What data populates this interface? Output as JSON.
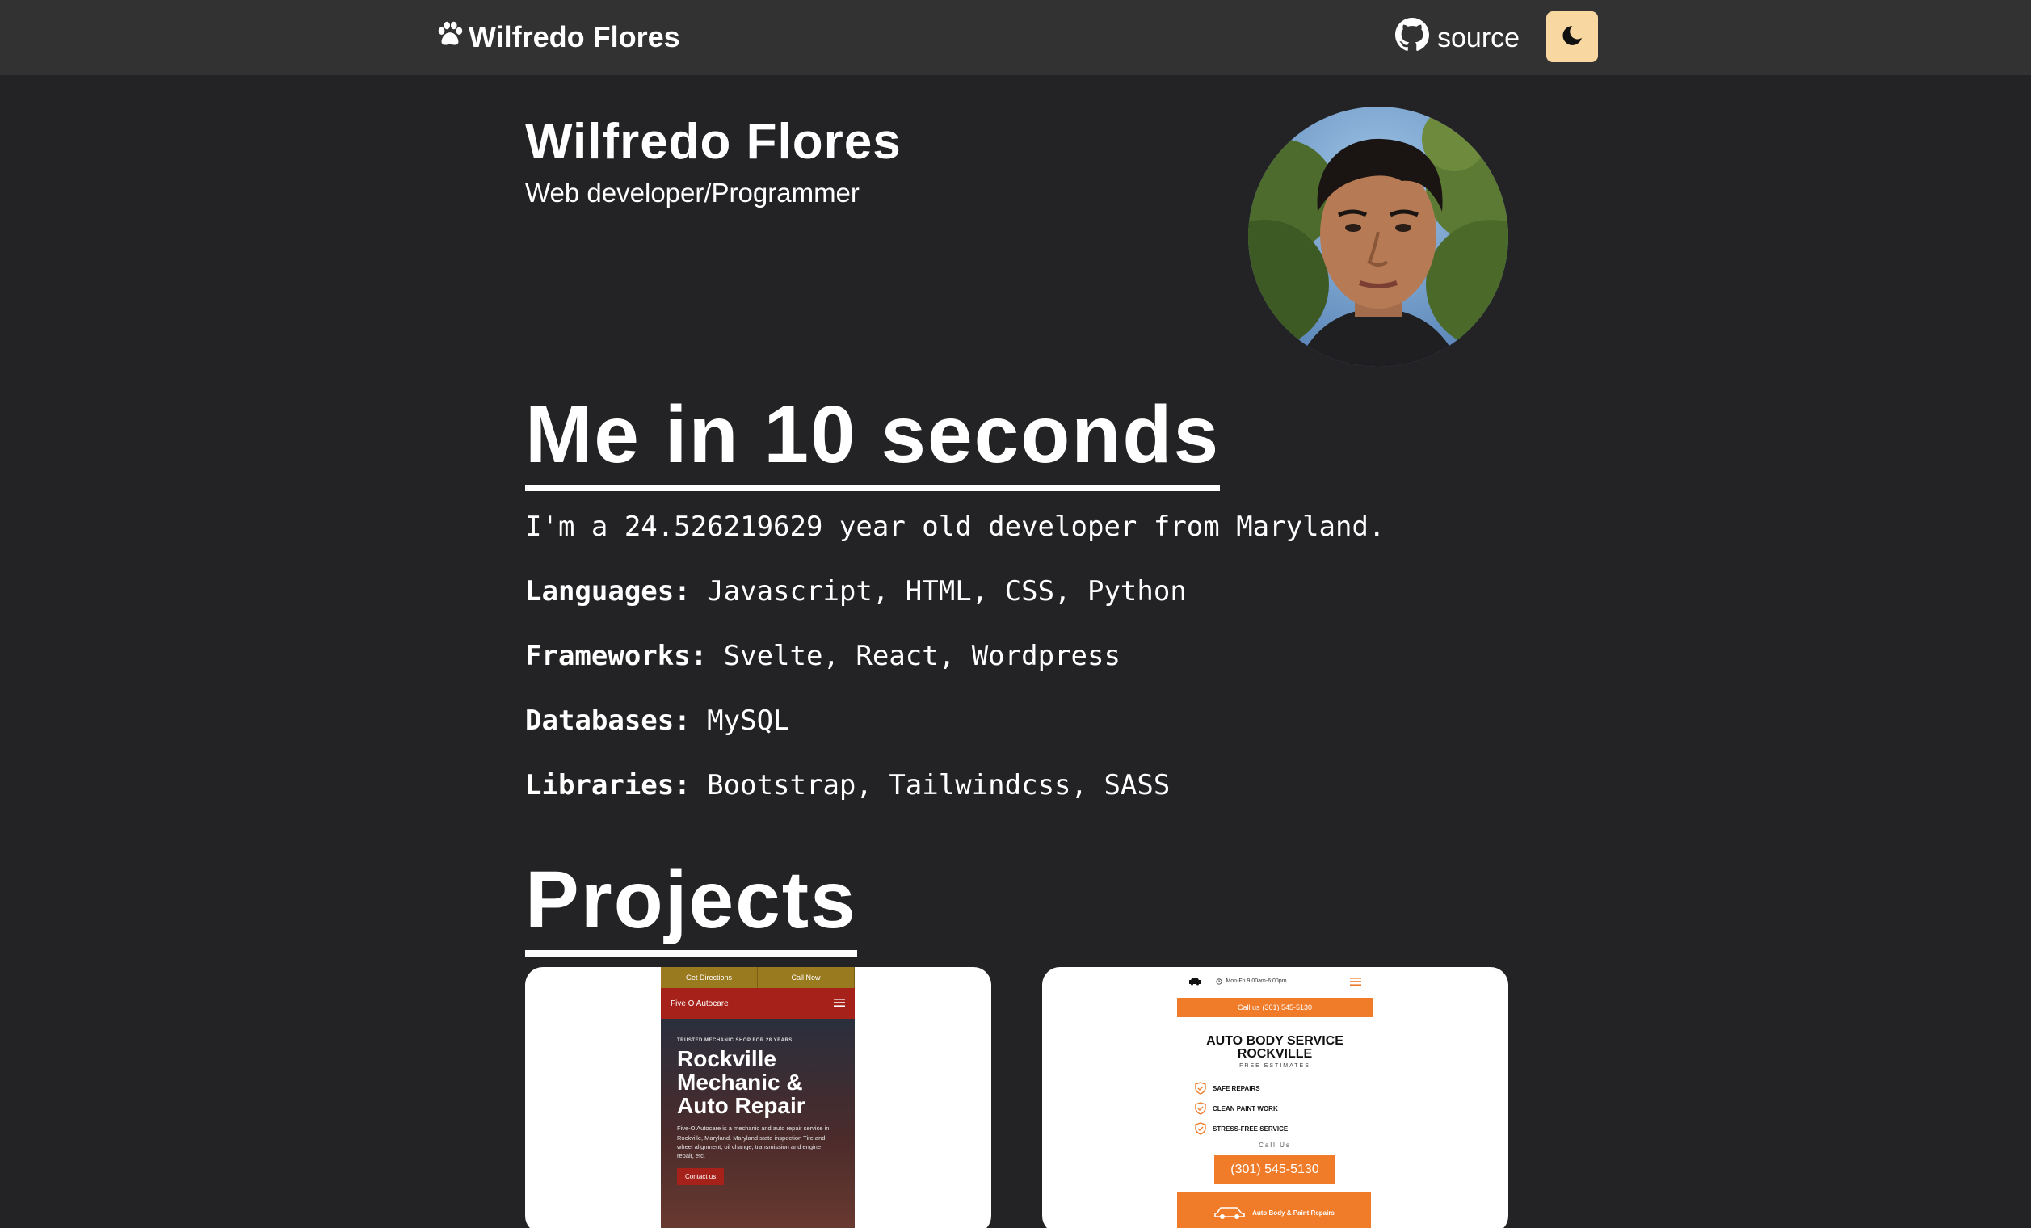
{
  "navbar": {
    "brand": "Wilfredo Flores",
    "source_label": "source",
    "theme_toggle_icon": "moon-icon"
  },
  "header": {
    "name": "Wilfredo Flores",
    "subtitle": "Web developer/Programmer"
  },
  "about": {
    "title": "Me in 10 seconds",
    "age_line": "I'm a 24.526219629 year old developer from Maryland.",
    "languages_label": "Languages:",
    "languages_value": " Javascript, HTML, CSS, Python",
    "frameworks_label": "Frameworks:",
    "frameworks_value": " Svelte, React, Wordpress",
    "databases_label": "Databases:",
    "databases_value": " MySQL",
    "libraries_label": "Libraries:",
    "libraries_value": " Bootstrap, Tailwindcss, SASS"
  },
  "projects": {
    "title": "Projects",
    "items": [
      {
        "topbar_left": "Get Directions",
        "topbar_right": "Call Now",
        "brand": "Five O Autocare",
        "tag": "TRUSTED MECHANIC SHOP FOR 28 YEARS",
        "headline": "Rockville Mechanic & Auto Repair",
        "desc": "Five-O Autocare is a mechanic and auto repair service in Rockville, Maryland. Maryland state inspection Tire and wheel alignment, oil change, transmission and engine repair, etc.",
        "cta": "Contact us"
      },
      {
        "hours": "Mon-Fri 9:00am-6:00pm",
        "call_text": "Call us",
        "call_number": "(301) 545-5130",
        "title_line1": "AUTO BODY SERVICE",
        "title_line2": "ROCKVILLE",
        "free": "FREE ESTIMATES",
        "checks": [
          "SAFE REPAIRS",
          "CLEAN PAINT WORK",
          "STRESS-FREE SERVICE"
        ],
        "call_us": "Call Us",
        "phone": "(301) 545-5130",
        "bottom": "Auto Body & Paint Repairs"
      }
    ]
  },
  "colors": {
    "background": "#232224",
    "navbar": "#333233",
    "theme_toggle": "#f8d8a0",
    "accent_orange": "#f07c2a",
    "accent_red": "#a52119"
  }
}
